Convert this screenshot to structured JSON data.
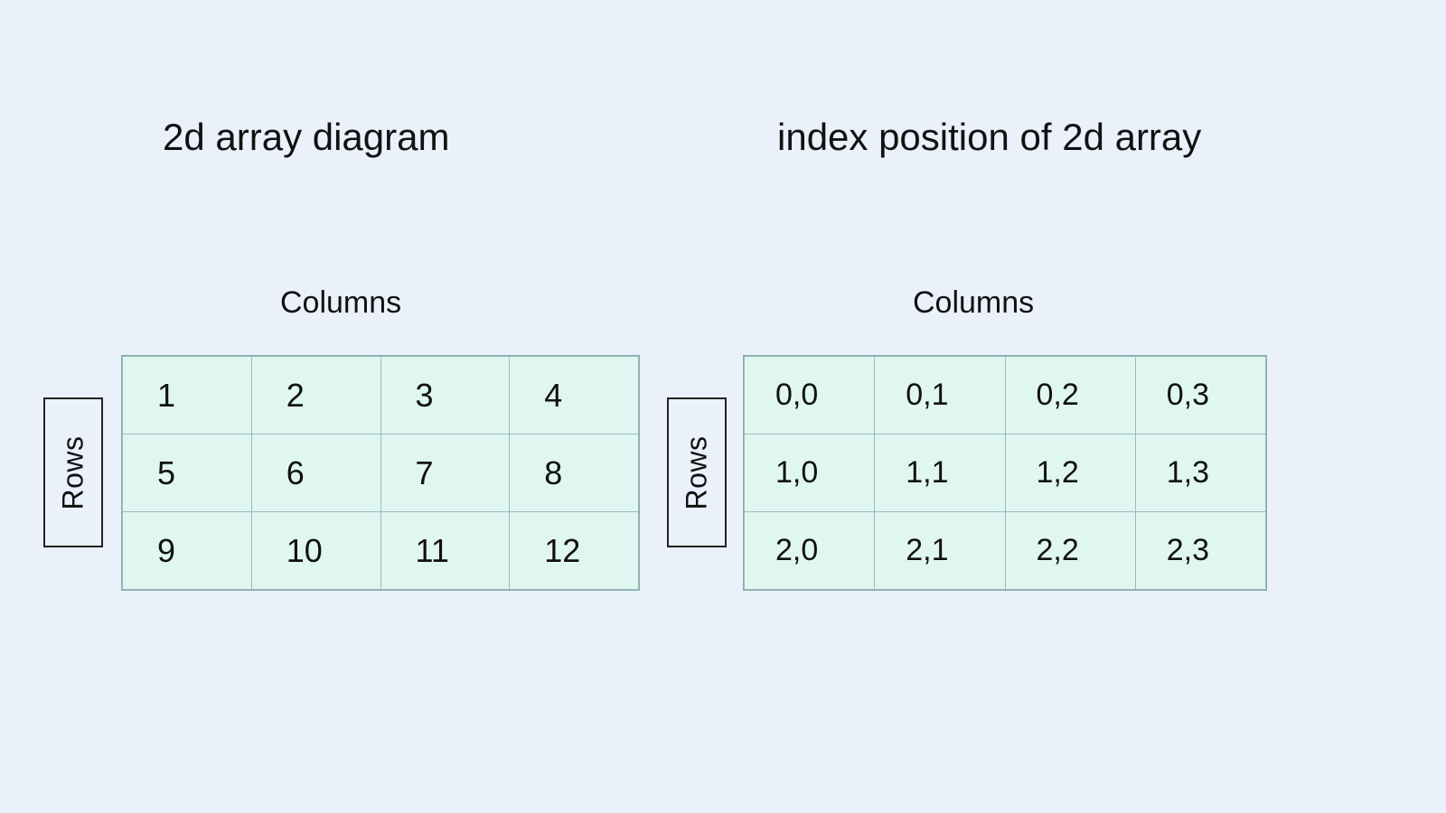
{
  "titles": {
    "left": "2d array diagram",
    "right": "index position of 2d array"
  },
  "axis_labels": {
    "columns": "Columns",
    "rows": "Rows"
  },
  "left_grid": {
    "rows": [
      [
        "1",
        "2",
        "3",
        "4"
      ],
      [
        "5",
        "6",
        "7",
        "8"
      ],
      [
        "9",
        "10",
        "11",
        "12"
      ]
    ]
  },
  "right_grid": {
    "rows": [
      [
        "0,0",
        "0,1",
        "0,2",
        "0,3"
      ],
      [
        "1,0",
        "1,1",
        "1,2",
        "1,3"
      ],
      [
        "2,0",
        "2,1",
        "2,2",
        "2,3"
      ]
    ]
  },
  "chart_data": [
    {
      "type": "table",
      "title": "2d array diagram",
      "xlabel": "Columns",
      "ylabel": "Rows",
      "values": [
        [
          1,
          2,
          3,
          4
        ],
        [
          5,
          6,
          7,
          8
        ],
        [
          9,
          10,
          11,
          12
        ]
      ]
    },
    {
      "type": "table",
      "title": "index position of 2d array",
      "xlabel": "Columns",
      "ylabel": "Rows",
      "values": [
        [
          "0,0",
          "0,1",
          "0,2",
          "0,3"
        ],
        [
          "1,0",
          "1,1",
          "1,2",
          "1,3"
        ],
        [
          "2,0",
          "2,1",
          "2,2",
          "2,3"
        ]
      ]
    }
  ]
}
